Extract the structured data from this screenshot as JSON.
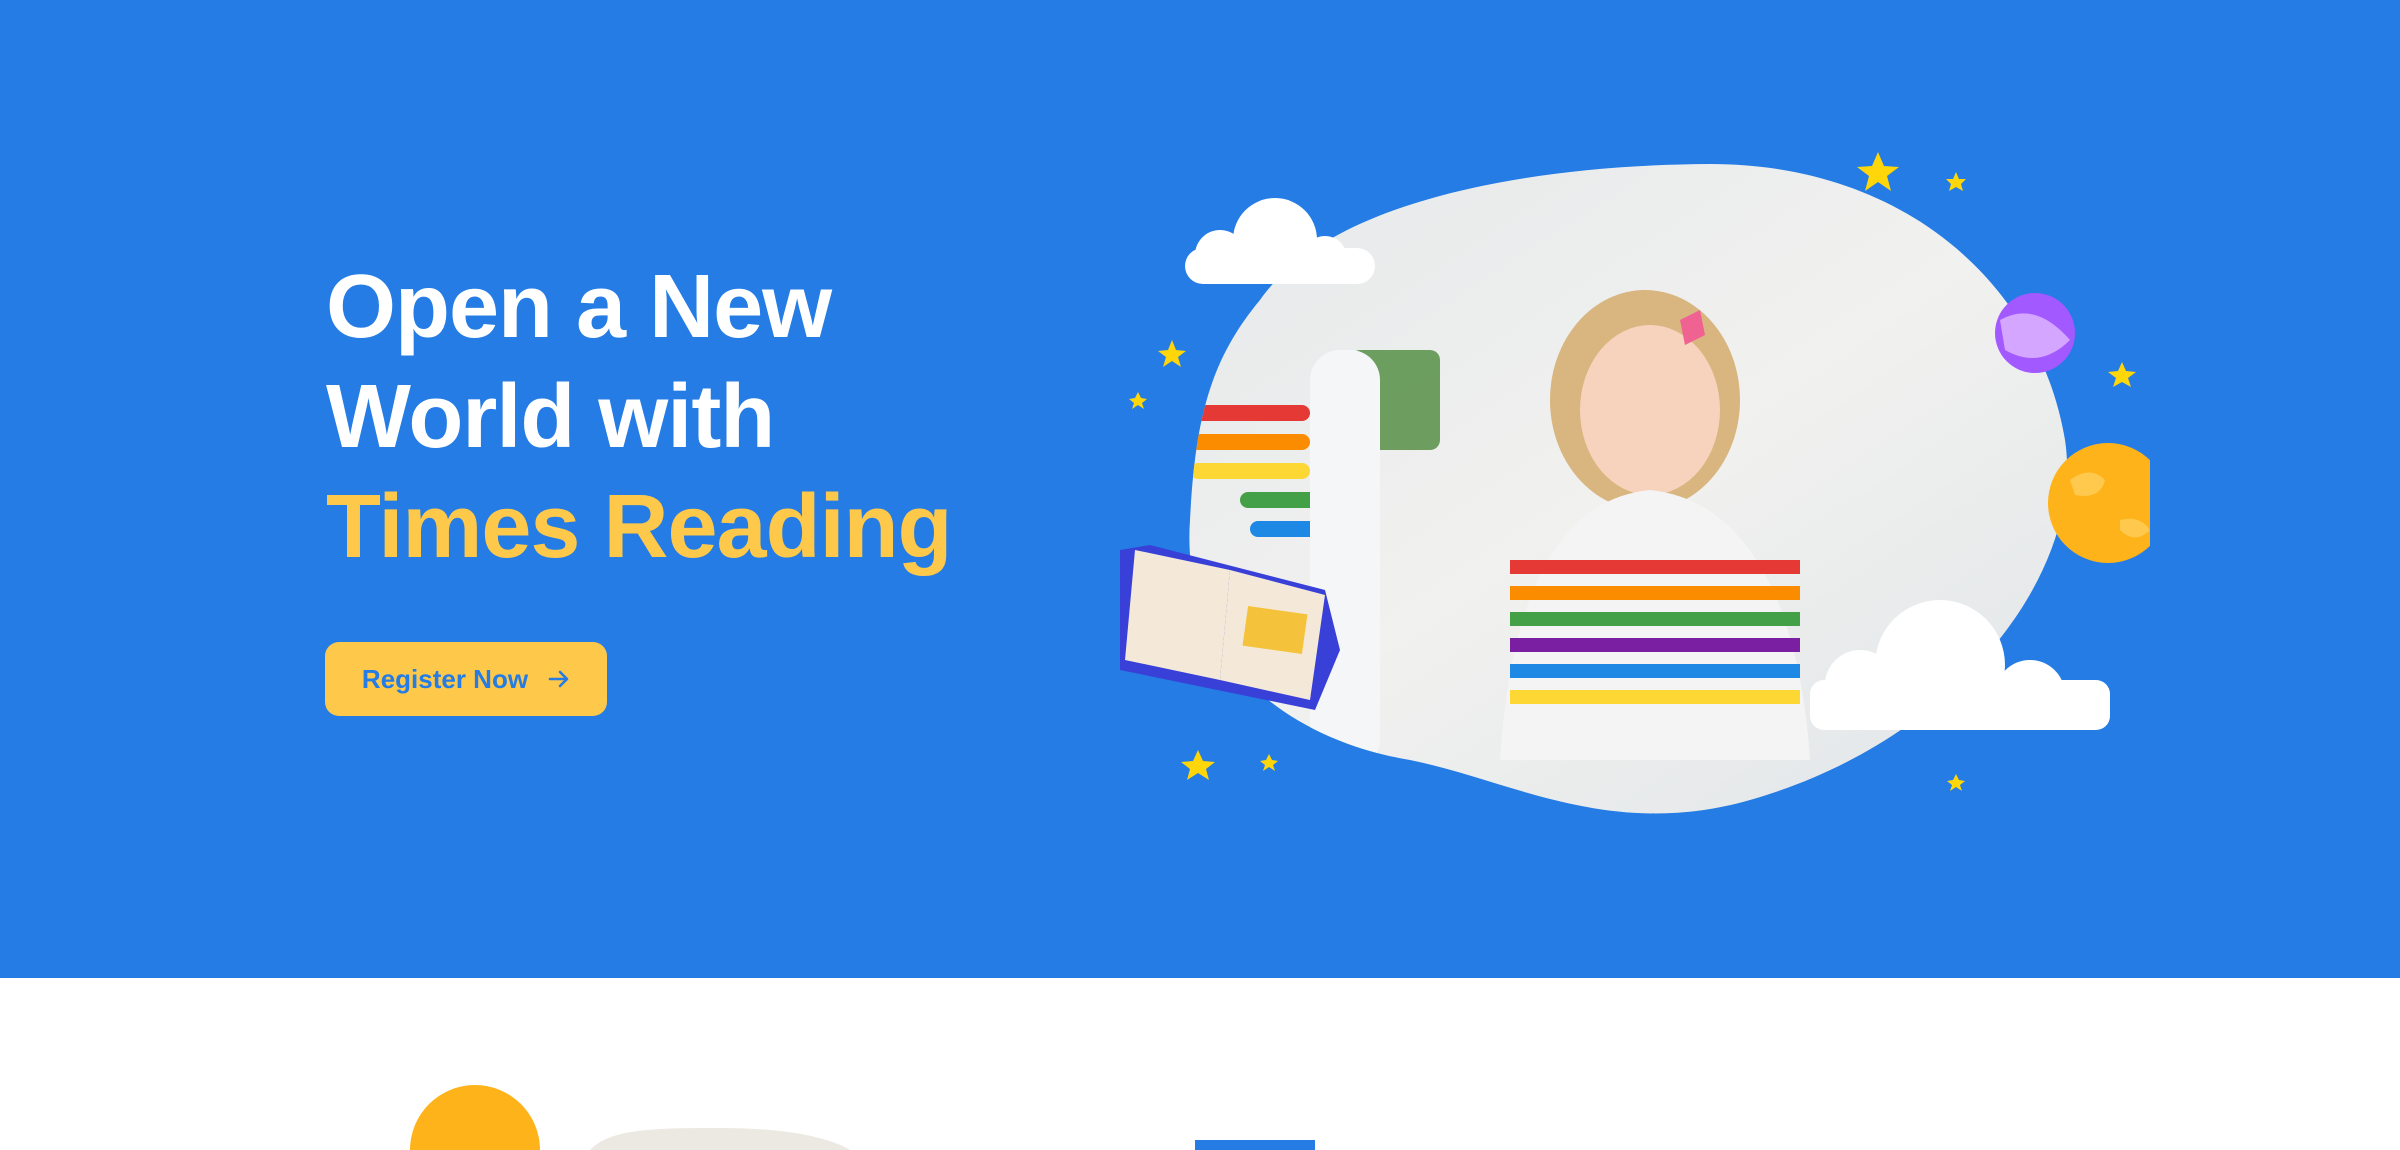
{
  "hero": {
    "title_line1": "Open a New",
    "title_line2": "World with",
    "title_accent": "Times Reading",
    "register_button": "Register Now",
    "register_icon": "arrow-right-icon"
  },
  "colors": {
    "hero_bg": "#247ce4",
    "accent": "#fec84b",
    "text": "#ffffff"
  }
}
